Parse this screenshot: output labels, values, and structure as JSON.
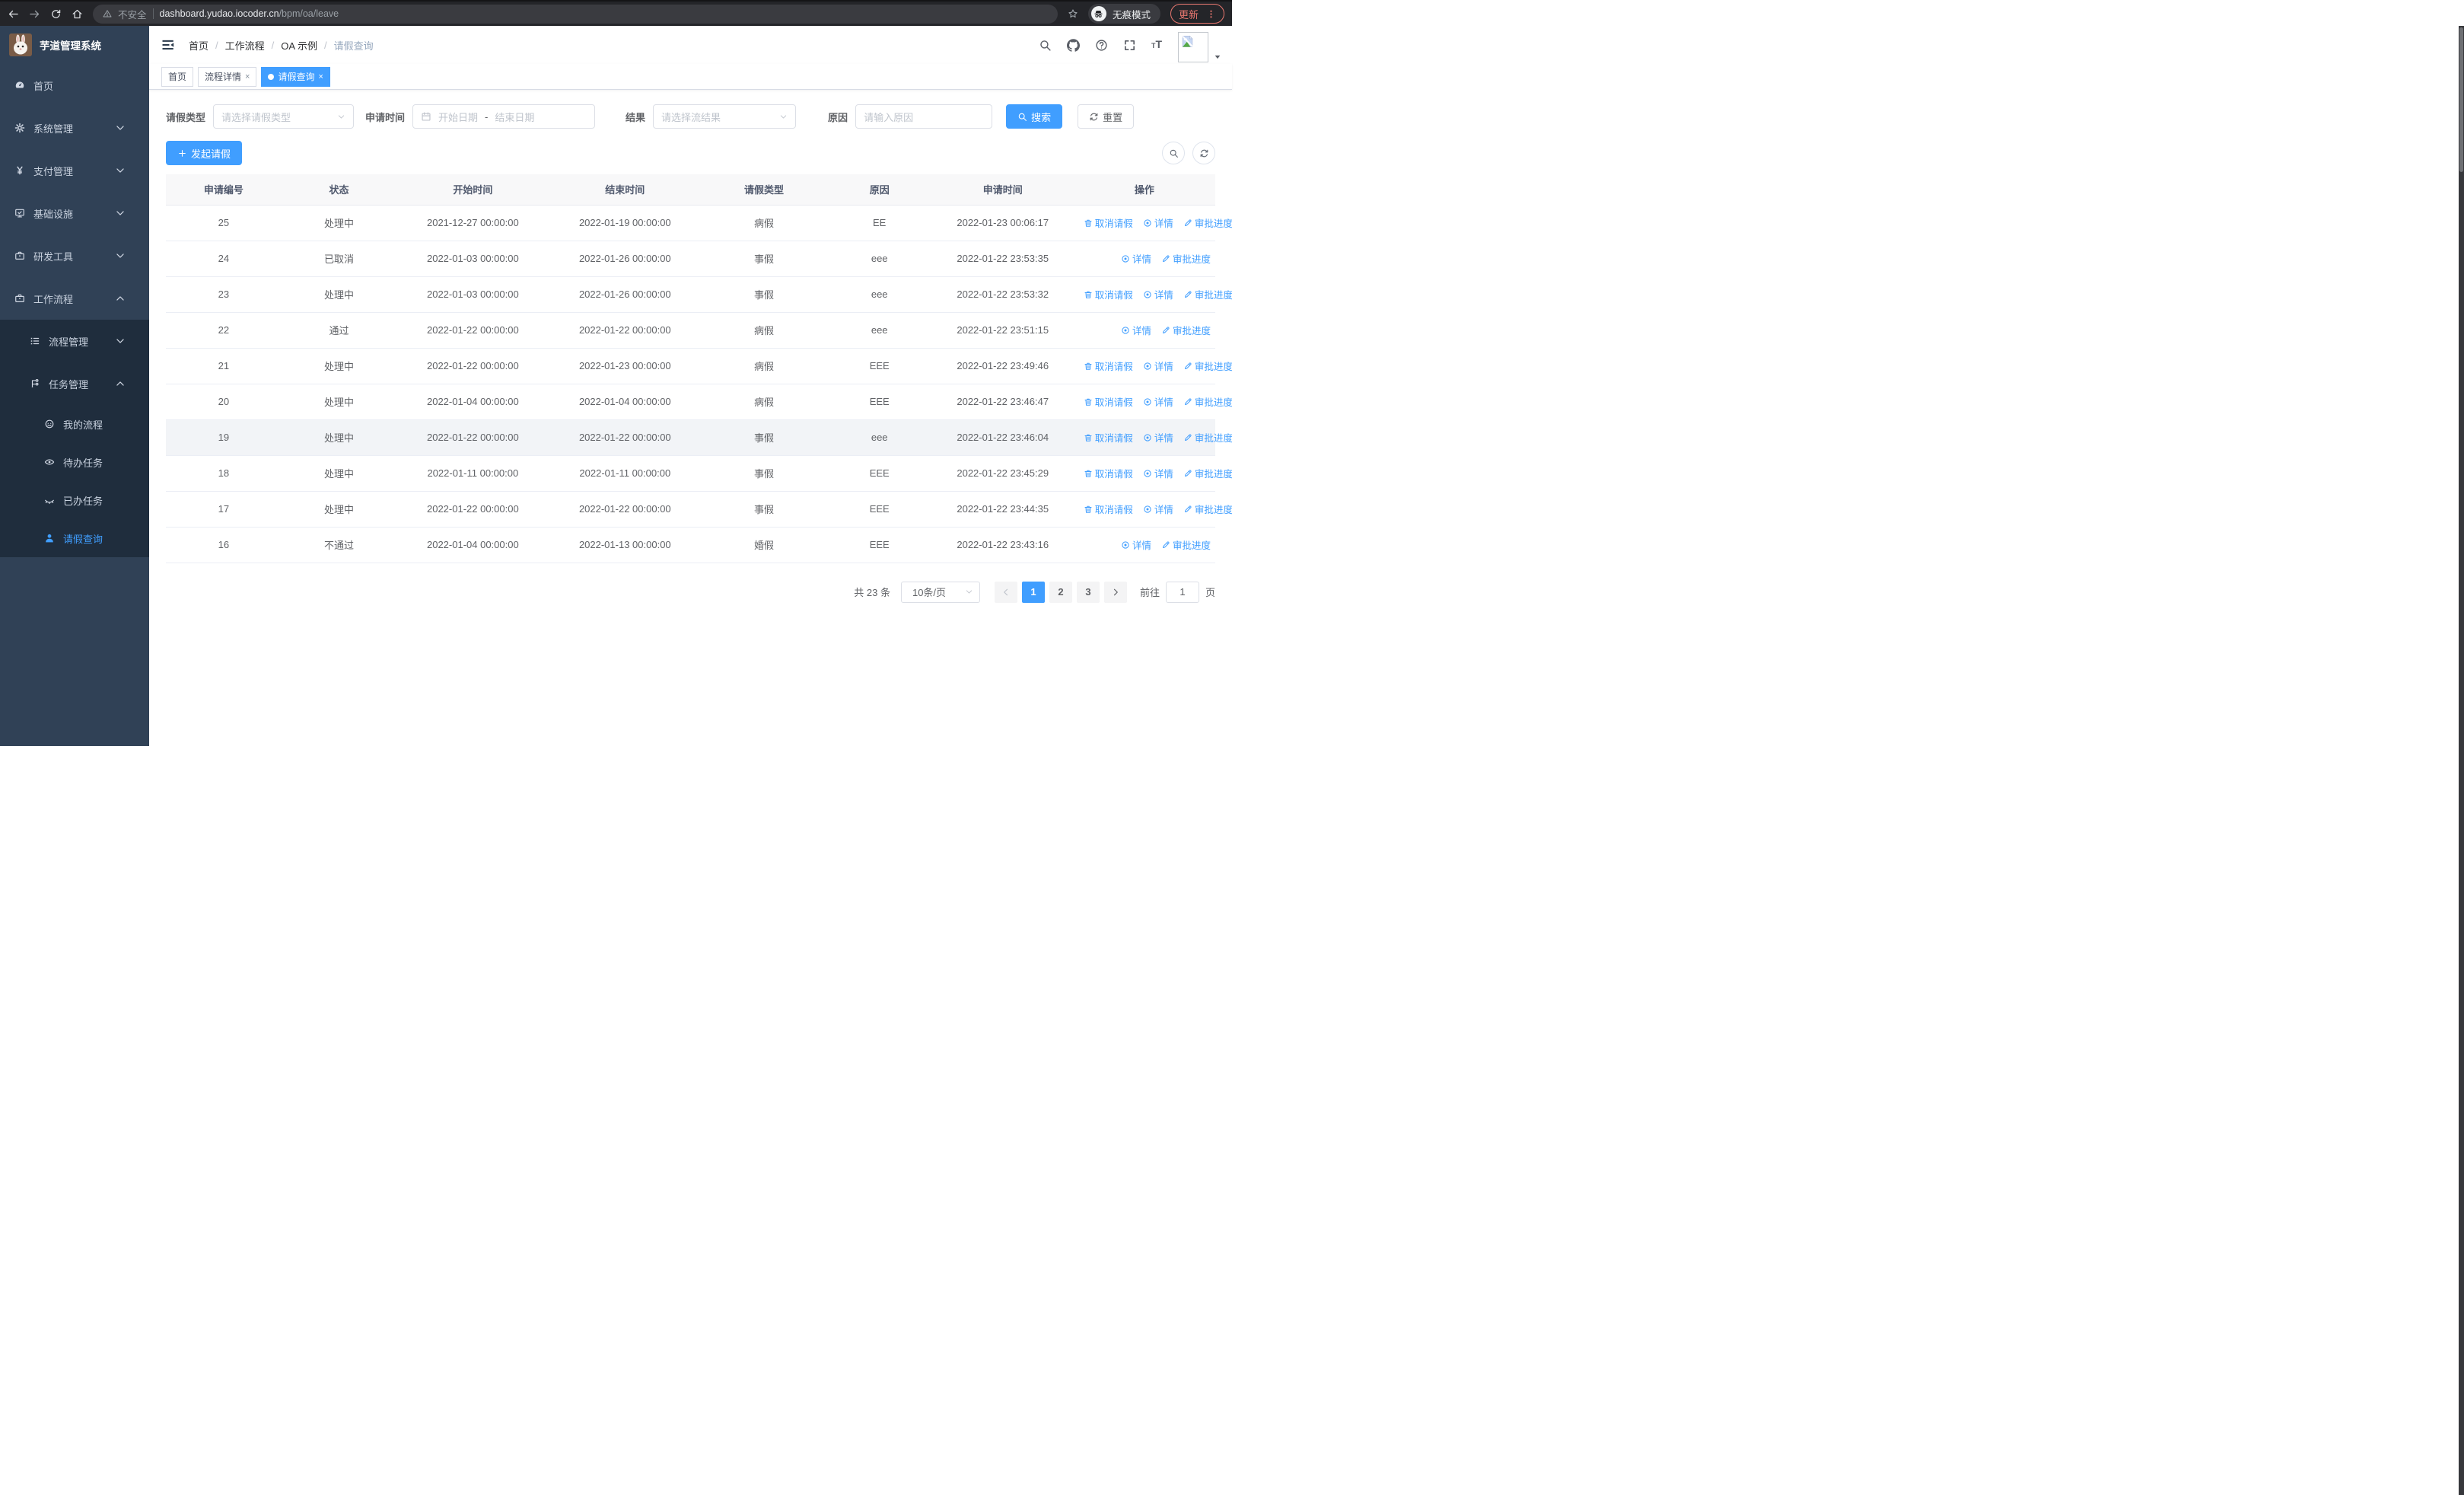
{
  "colors": {
    "accent": "#409eff",
    "sidebar_bg": "#304156",
    "submenu_bg": "#1f2d3d",
    "update": "#e8776f"
  },
  "browser": {
    "security_label": "不安全",
    "url_host": "dashboard.yudao.iocoder.cn",
    "url_path": "/bpm/oa/leave",
    "incognito_label": "无痕模式",
    "update_label": "更新"
  },
  "sidebar": {
    "title": "芋道管理系统",
    "items": [
      {
        "label": "首页",
        "icon": "gauge-icon",
        "level": 1
      },
      {
        "label": "系统管理",
        "icon": "gear-icon",
        "level": 1,
        "chevron": "down"
      },
      {
        "label": "支付管理",
        "icon": "yen-icon",
        "level": 1,
        "chevron": "down"
      },
      {
        "label": "基础设施",
        "icon": "monitor-icon",
        "level": 1,
        "chevron": "down"
      },
      {
        "label": "研发工具",
        "icon": "briefcase-icon",
        "level": 1,
        "chevron": "down"
      },
      {
        "label": "工作流程",
        "icon": "briefcase-icon",
        "level": 1,
        "chevron": "up"
      },
      {
        "label": "流程管理",
        "icon": "tree-icon",
        "level": 2,
        "chevron": "down",
        "submenu": true
      },
      {
        "label": "任务管理",
        "icon": "flow-icon",
        "level": 2,
        "chevron": "up",
        "submenu": true
      },
      {
        "label": "我的流程",
        "icon": "face-icon",
        "level": 3,
        "submenu": true
      },
      {
        "label": "待办任务",
        "icon": "eye-icon",
        "level": 3,
        "submenu": true
      },
      {
        "label": "已办任务",
        "icon": "eye-closed-icon",
        "level": 3,
        "submenu": true
      },
      {
        "label": "请假查询",
        "icon": "user-icon",
        "level": 3,
        "submenu": true,
        "active": true
      }
    ]
  },
  "breadcrumb": [
    {
      "label": "首页"
    },
    {
      "label": "工作流程"
    },
    {
      "label": "OA 示例"
    },
    {
      "label": "请假查询",
      "current": true
    }
  ],
  "tabs": [
    {
      "label": "首页"
    },
    {
      "label": "流程详情",
      "closable": true
    },
    {
      "label": "请假查询",
      "closable": true,
      "active": true
    }
  ],
  "filters": {
    "leave_type": {
      "label": "请假类型",
      "placeholder": "请选择请假类型"
    },
    "apply_time": {
      "label": "申请时间",
      "start_placeholder": "开始日期",
      "separator": "-",
      "end_placeholder": "结束日期"
    },
    "result": {
      "label": "结果",
      "placeholder": "请选择流结果"
    },
    "reason": {
      "label": "原因",
      "placeholder": "请输入原因"
    },
    "search_label": "搜索",
    "reset_label": "重置"
  },
  "toolbar": {
    "create_label": "发起请假"
  },
  "table": {
    "columns": [
      "申请编号",
      "状态",
      "开始时间",
      "结束时间",
      "请假类型",
      "原因",
      "申请时间",
      "操作"
    ],
    "action_labels": {
      "cancel": "取消请假",
      "detail": "详情",
      "progress": "审批进度"
    },
    "rows": [
      {
        "id": "25",
        "status": "处理中",
        "start": "2021-12-27 00:00:00",
        "end": "2022-01-19 00:00:00",
        "type": "病假",
        "reason": "EE",
        "apply": "2022-01-23 00:06:17",
        "actions": [
          "cancel",
          "detail",
          "progress"
        ]
      },
      {
        "id": "24",
        "status": "已取消",
        "start": "2022-01-03 00:00:00",
        "end": "2022-01-26 00:00:00",
        "type": "事假",
        "reason": "eee",
        "apply": "2022-01-22 23:53:35",
        "actions": [
          "detail",
          "progress"
        ]
      },
      {
        "id": "23",
        "status": "处理中",
        "start": "2022-01-03 00:00:00",
        "end": "2022-01-26 00:00:00",
        "type": "事假",
        "reason": "eee",
        "apply": "2022-01-22 23:53:32",
        "actions": [
          "cancel",
          "detail",
          "progress"
        ]
      },
      {
        "id": "22",
        "status": "通过",
        "start": "2022-01-22 00:00:00",
        "end": "2022-01-22 00:00:00",
        "type": "病假",
        "reason": "eee",
        "apply": "2022-01-22 23:51:15",
        "actions": [
          "detail",
          "progress"
        ]
      },
      {
        "id": "21",
        "status": "处理中",
        "start": "2022-01-22 00:00:00",
        "end": "2022-01-23 00:00:00",
        "type": "病假",
        "reason": "EEE",
        "apply": "2022-01-22 23:49:46",
        "actions": [
          "cancel",
          "detail",
          "progress"
        ]
      },
      {
        "id": "20",
        "status": "处理中",
        "start": "2022-01-04 00:00:00",
        "end": "2022-01-04 00:00:00",
        "type": "病假",
        "reason": "EEE",
        "apply": "2022-01-22 23:46:47",
        "actions": [
          "cancel",
          "detail",
          "progress"
        ]
      },
      {
        "id": "19",
        "status": "处理中",
        "start": "2022-01-22 00:00:00",
        "end": "2022-01-22 00:00:00",
        "type": "事假",
        "reason": "eee",
        "apply": "2022-01-22 23:46:04",
        "actions": [
          "cancel",
          "detail",
          "progress"
        ],
        "highlight": true
      },
      {
        "id": "18",
        "status": "处理中",
        "start": "2022-01-11 00:00:00",
        "end": "2022-01-11 00:00:00",
        "type": "事假",
        "reason": "EEE",
        "apply": "2022-01-22 23:45:29",
        "actions": [
          "cancel",
          "detail",
          "progress"
        ]
      },
      {
        "id": "17",
        "status": "处理中",
        "start": "2022-01-22 00:00:00",
        "end": "2022-01-22 00:00:00",
        "type": "事假",
        "reason": "EEE",
        "apply": "2022-01-22 23:44:35",
        "actions": [
          "cancel",
          "detail",
          "progress"
        ]
      },
      {
        "id": "16",
        "status": "不通过",
        "start": "2022-01-04 00:00:00",
        "end": "2022-01-13 00:00:00",
        "type": "婚假",
        "reason": "EEE",
        "apply": "2022-01-22 23:43:16",
        "actions": [
          "detail",
          "progress"
        ]
      }
    ]
  },
  "pagination": {
    "total_label": "共 23 条",
    "page_size_label": "10条/页",
    "pages": [
      "1",
      "2",
      "3"
    ],
    "current_page": "1",
    "goto_label": "前往",
    "goto_value": "1",
    "goto_suffix": "页"
  }
}
